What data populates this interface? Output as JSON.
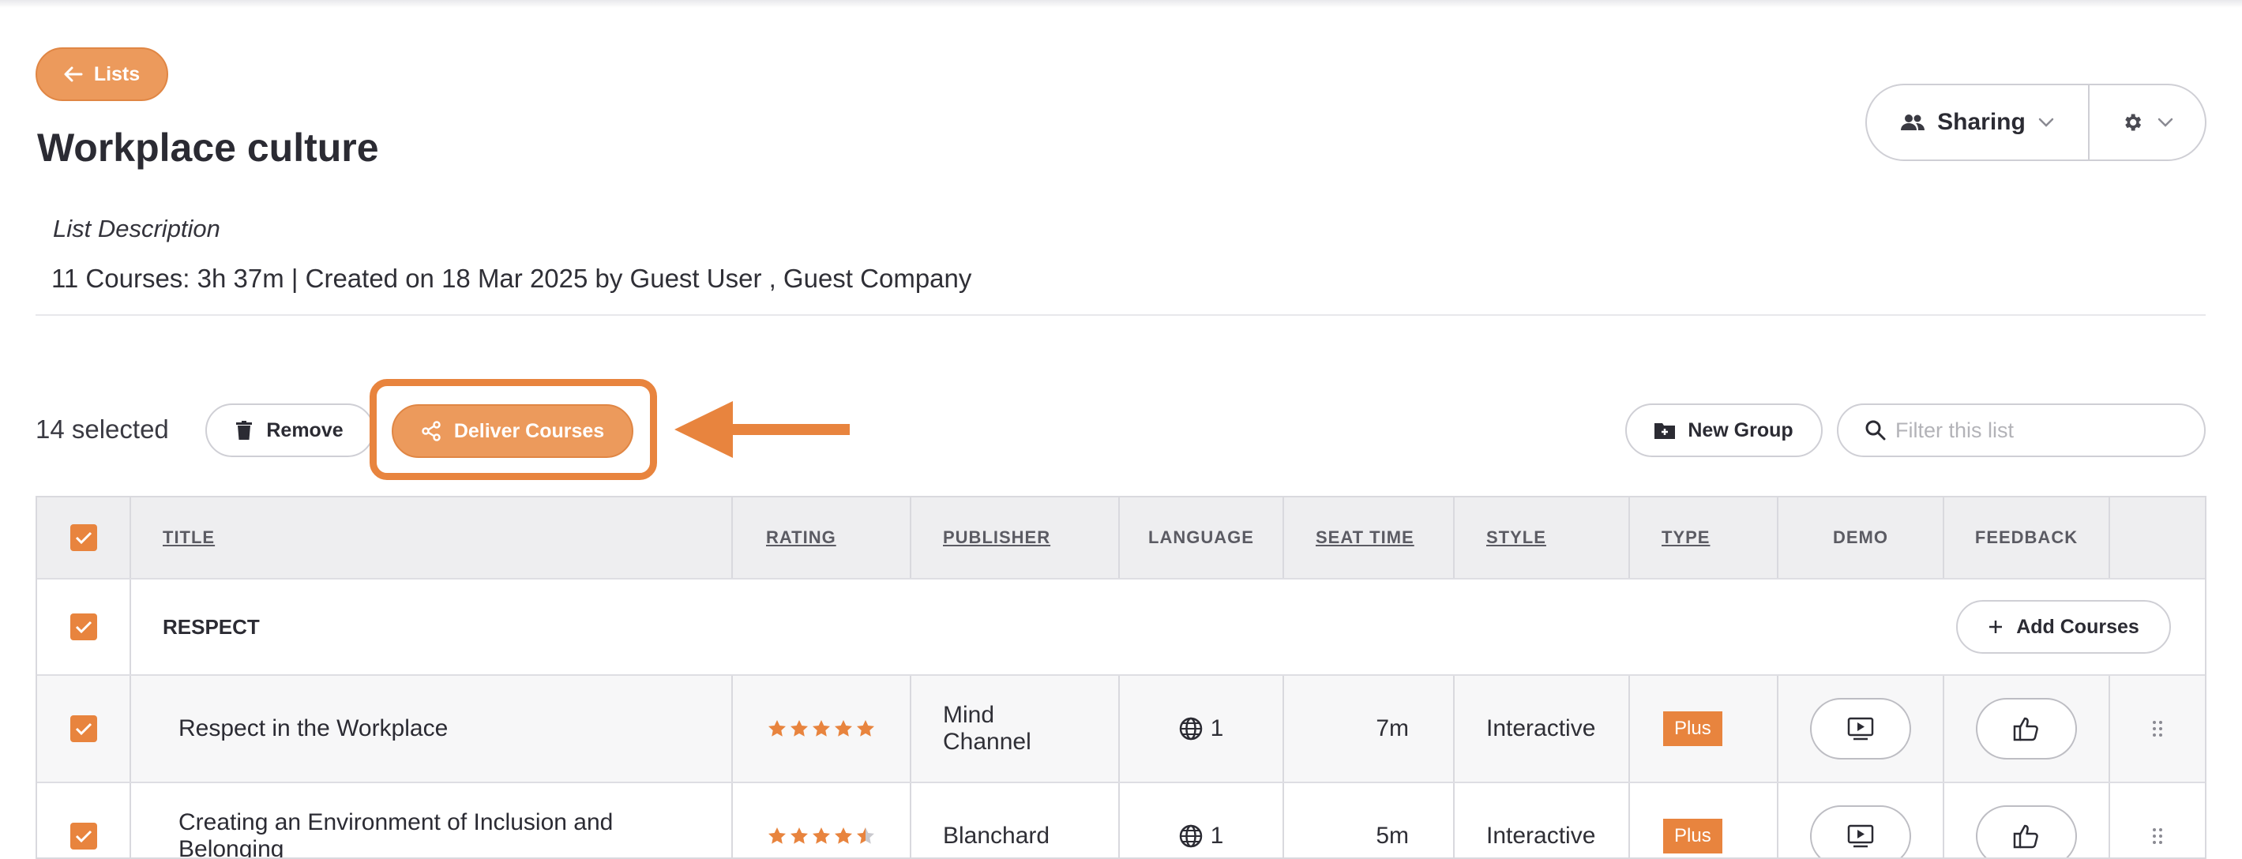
{
  "nav": {
    "back_label": "Lists"
  },
  "page": {
    "title": "Workplace culture",
    "description_label": "List Description",
    "meta": "11 Courses: 3h 37m | Created on 18 Mar 2025 by Guest User , Guest Company"
  },
  "header_actions": {
    "sharing_label": "Sharing"
  },
  "toolbar": {
    "selected_text": "14 selected",
    "remove_label": "Remove",
    "deliver_label": "Deliver Courses",
    "new_group_label": "New Group",
    "filter_placeholder": "Filter this list"
  },
  "table": {
    "columns": [
      "TITLE",
      "RATING",
      "PUBLISHER",
      "LANGUAGE",
      "SEAT TIME",
      "STYLE",
      "TYPE",
      "DEMO",
      "FEEDBACK"
    ],
    "group": {
      "name": "RESPECT",
      "add_label": "Add Courses"
    },
    "rows": [
      {
        "title": "Respect in the Workplace",
        "rating": 5,
        "publisher_line1": "Mind",
        "publisher_line2": "Channel",
        "language_count": "1",
        "seat_time": "7m",
        "style": "Interactive",
        "type": "Plus"
      },
      {
        "title_line1": "Creating an Environment of Inclusion and",
        "title_line2": "Belonging",
        "rating": 4.5,
        "publisher": "Blanchard",
        "language_count": "1",
        "seat_time": "5m",
        "style": "Interactive",
        "type": "Plus"
      }
    ]
  },
  "colors": {
    "accent": "#e8843e",
    "accent_light": "#ec9a5c",
    "border": "#cfcfd5",
    "header_bg": "#eeeef0"
  }
}
